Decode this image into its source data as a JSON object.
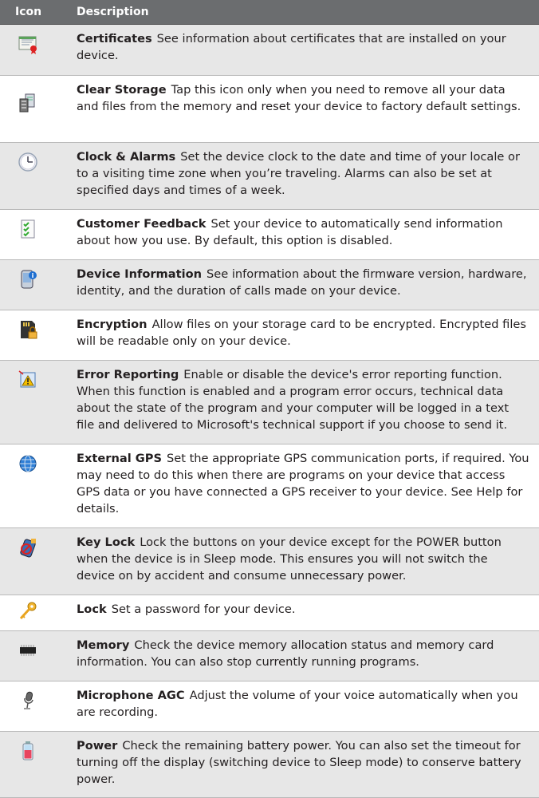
{
  "header": {
    "icon_label": "Icon",
    "desc_label": "Description"
  },
  "rows": [
    {
      "icon": "certificates-icon",
      "title": "Certificates",
      "text": "See information about certificates that are installed on your device."
    },
    {
      "icon": "clear-storage-icon",
      "title": "Clear Storage",
      "text": "Tap this icon only when you need to remove all your data and files from the memory and reset your device to factory default settings."
    },
    {
      "icon": "clock-icon",
      "title": "Clock & Alarms",
      "text": "Set the device clock to the date and time of your locale or to a visiting time zone when you’re traveling. Alarms can also be set at specified days and times of a week."
    },
    {
      "icon": "customer-feedback-icon",
      "title": "Customer Feedback",
      "text": "Set your device to automatically send information about how you use. By default, this option is disabled."
    },
    {
      "icon": "device-information-icon",
      "title": "Device Information",
      "text": "See information about the firmware version, hardware, identity, and the duration of calls made on your device."
    },
    {
      "icon": "encryption-icon",
      "title": "Encryption",
      "text": "Allow files on your storage card to be encrypted. Encrypted files will be readable only on your device."
    },
    {
      "icon": "error-reporting-icon",
      "title": "Error Reporting",
      "text": "Enable or disable the device's error reporting function. When this function is enabled and a program error occurs, technical data about the state of the program and your computer will be logged in a text file and delivered to Microsoft's technical support if you choose to send it."
    },
    {
      "icon": "external-gps-icon",
      "title": "External GPS",
      "text": "Set the appropriate GPS communication ports, if required. You may need to do this when there are programs on your device that access GPS data or you have connected a GPS receiver to your device. See Help for details."
    },
    {
      "icon": "key-lock-icon",
      "title": "Key Lock",
      "text": "Lock the buttons on your device except for the POWER button when the device is in Sleep mode. This ensures you will not switch the device on by accident and consume unnecessary power."
    },
    {
      "icon": "lock-icon",
      "title": "Lock",
      "text": "Set a password for your device."
    },
    {
      "icon": "memory-icon",
      "title": "Memory",
      "text": "Check the device memory allocation status and memory card information. You can also stop currently running programs."
    },
    {
      "icon": "microphone-icon",
      "title": "Microphone AGC",
      "text": "Adjust the volume of your voice automatically when you are recording."
    },
    {
      "icon": "power-icon",
      "title": "Power",
      "text": "Check the remaining battery power. You can also set the timeout for turning off the display (switching device to Sleep mode) to conserve battery power."
    }
  ]
}
